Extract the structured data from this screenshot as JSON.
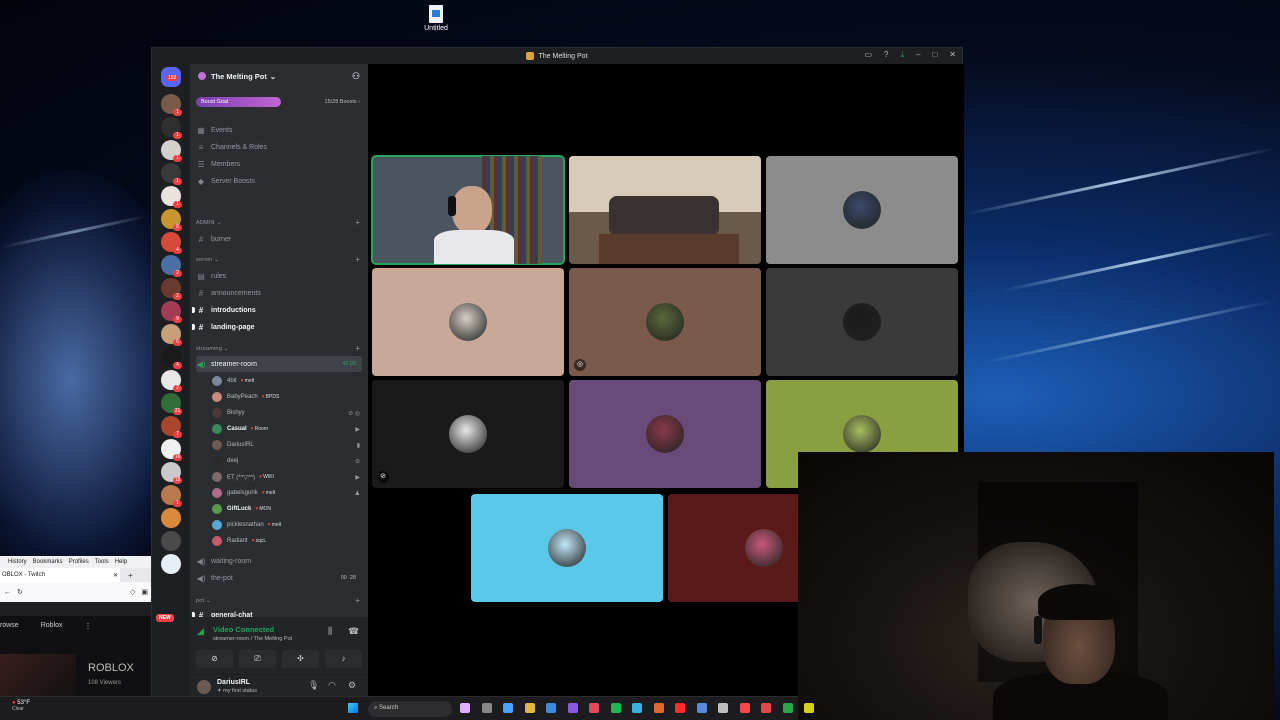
{
  "desktop": {
    "icon_label": "Untitled"
  },
  "browser": {
    "menu": [
      "History",
      "Bookmarks",
      "Profiles",
      "Tools",
      "Help"
    ],
    "tab_title": "OBLOX - Twitch",
    "nav": [
      "rowse",
      "Roblox"
    ],
    "game_title": "ROBLOX",
    "viewers": "108 Viewers"
  },
  "window": {
    "title": "The Melting Pot"
  },
  "guilds": {
    "top_badge": "192",
    "new_label": "NEW",
    "badges": [
      "1",
      "1",
      "1",
      "1",
      "1",
      "8",
      "4",
      "2",
      "2",
      "9",
      "6",
      "4",
      "2",
      "21",
      "7",
      "16",
      "18",
      "1"
    ],
    "colors": [
      "#7a5b4a",
      "#2f2f2f",
      "#d4d0cc",
      "#3a3a3a",
      "#e8e3dc",
      "#c8962f",
      "#d64a3a",
      "#4a6fa5",
      "#6b3b2f",
      "#a33b55",
      "#c7a07a",
      "#1a1a1a",
      "#e8e8e8",
      "#2f6f3a",
      "#a8452a",
      "#f0f0f0",
      "#c9c9c9",
      "#b87a4a",
      "#d88a3a",
      "#4a4a4a",
      "#e8eef8"
    ]
  },
  "server": {
    "name": "The Melting Pot",
    "boost_goal": "Boost Goal",
    "boost_count": "15/28 Boosts"
  },
  "menu_items": [
    {
      "icon": "calendar-icon",
      "glyph": "▦",
      "label": "Events"
    },
    {
      "icon": "channels-roles-icon",
      "glyph": "≡",
      "label": "Channels & Roles"
    },
    {
      "icon": "members-icon",
      "glyph": "☰",
      "label": "Members"
    },
    {
      "icon": "boost-icon",
      "glyph": "◆",
      "label": "Server Boosts"
    }
  ],
  "categories": {
    "admin": "ADMIN",
    "server": "server",
    "streaming": "streaming",
    "pot": "pot"
  },
  "channels": {
    "burner": "burner",
    "rules": "rules",
    "announcements": "announcements",
    "introductions": "introductions",
    "landing_page": "landing-page",
    "streamer_room": "streamer-room",
    "streamer_room_time": "42:26",
    "waiting_room": "waiting-room",
    "the_pot": "the-pot",
    "the_pot_count_a": "00",
    "the_pot_count_b": "28",
    "general_chat": "general-chat"
  },
  "voice_users": [
    {
      "name": "4bit",
      "tag": "melt",
      "bold": false,
      "color": "#7a8a9a",
      "icon": ""
    },
    {
      "name": "BabyPeach",
      "tag": "BPDS",
      "bold": false,
      "color": "#c98a7a",
      "icon": ""
    },
    {
      "name": "Bishyy",
      "tag": "",
      "bold": false,
      "color": "#4a3a3a",
      "icon": "⊘ ◎"
    },
    {
      "name": "Casual",
      "tag": "Room",
      "bold": true,
      "color": "#3a8a5a",
      "icon": "▶"
    },
    {
      "name": "DariusIRL",
      "tag": "",
      "bold": false,
      "color": "#6b5b52",
      "icon": "▮"
    },
    {
      "name": "deej",
      "tag": "",
      "bold": false,
      "color": "#2a2a2a",
      "icon": "⊘"
    },
    {
      "name": "ET (*^▽^*)",
      "tag": "WIKI",
      "bold": false,
      "color": "#7a6a6a",
      "icon": "▶"
    },
    {
      "name": "gabelsgunk",
      "tag": "melt",
      "bold": false,
      "color": "#b06a8a",
      "icon": "♟"
    },
    {
      "name": "GiftLuck",
      "tag": "MON",
      "bold": true,
      "color": "#5a9a4a",
      "icon": ""
    },
    {
      "name": "picklesnathan",
      "tag": "melt",
      "bold": false,
      "color": "#5aa8d8",
      "icon": ""
    },
    {
      "name": "Radiant",
      "tag": "sqcL",
      "bold": false,
      "color": "#c85a6a",
      "icon": ""
    }
  ],
  "rtc": {
    "status": "Video Connected",
    "location": "streamer-room / The Melting Pot"
  },
  "user": {
    "name": "DariusIRL",
    "status": "my first status"
  },
  "tiles": [
    {
      "kind": "video-person",
      "bg": "#4a5560"
    },
    {
      "kind": "video-room",
      "bg": "#6b5a4a"
    },
    {
      "kind": "avatar",
      "bg": "#8c8c8c",
      "avatar": "#3a4a6a"
    },
    {
      "kind": "avatar",
      "bg": "#c8a898",
      "avatar": "#d8cfc6"
    },
    {
      "kind": "avatar",
      "bg": "#7a5a4a",
      "avatar": "#5a6a3a"
    },
    {
      "kind": "avatar",
      "bg": "#3a3a3a",
      "avatar": "#1a1a1a"
    },
    {
      "kind": "avatar",
      "bg": "#1a1a1a",
      "avatar": "#e8e8e8"
    },
    {
      "kind": "avatar",
      "bg": "#6a4a78",
      "avatar": "#8a3a4a"
    },
    {
      "kind": "avatar",
      "bg": "#8aa040",
      "avatar": "#a8c060"
    },
    {
      "kind": "avatar",
      "bg": "#5ac8e8",
      "avatar": "#c0e8f8"
    },
    {
      "kind": "avatar",
      "bg": "#5a1a1a",
      "avatar": "#c85a7a"
    }
  ],
  "taskbar": {
    "temp": "53°F",
    "weather": "Clear",
    "search": "Search",
    "app_colors": [
      "#e0b0ff",
      "#888",
      "#4aa3ff",
      "#e0b840",
      "#3a8ae0",
      "#8a5ae0",
      "#e04a5a",
      "#1db954",
      "#3ab0e0",
      "#e06a2a",
      "#ff2a2a",
      "#5a8ae0",
      "#c0c0c0",
      "#f04a4a",
      "#e04a4a",
      "#2aa84a",
      "#d8d020"
    ]
  }
}
